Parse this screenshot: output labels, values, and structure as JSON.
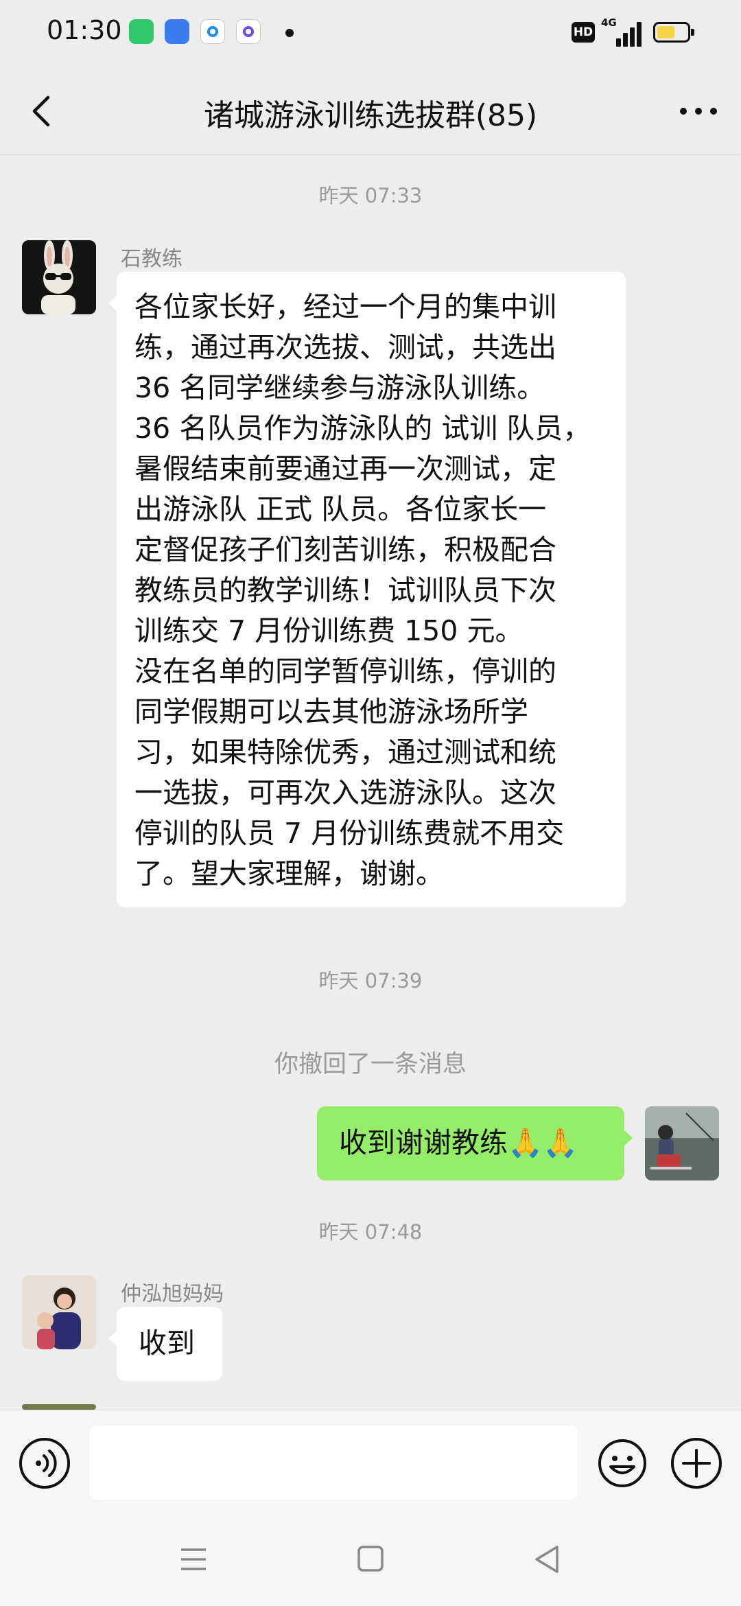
{
  "status_bar": {
    "time": "01:30",
    "hd": "HD",
    "network": "4G",
    "battery_percent": 60,
    "app_icons": [
      {
        "name": "green-app-icon",
        "color": "#2fc86b"
      },
      {
        "name": "blue-chat-app-icon",
        "color": "#3a7cf0"
      },
      {
        "name": "blue-dot-app-icon",
        "color": "#1d8bf0"
      },
      {
        "name": "purple-app-icon",
        "color": "#6b4fd6"
      }
    ]
  },
  "header": {
    "title": "诸城游泳训练选拔群(85)",
    "back_icon": "chevron-left-icon",
    "more_icon": "more-dots-icon"
  },
  "messages": [
    {
      "time": "昨天 07:33",
      "sender": "石教练",
      "lines": [
        "各位家长好，经过一个月的集中训",
        "练，通过再次选拔、测试，共选出",
        "36 名同学继续参与游泳队训练。",
        "36 名队员作为游泳队的 试训 队员，",
        "暑假结束前要通过再一次测试，定",
        "出游泳队 正式 队员。各位家长一",
        "定督促孩子们刻苦训练，积极配合",
        "教练员的教学训练！试训队员下次",
        "训练交 7 月份训练费 150 元。",
        "没在名单的同学暂停训练，停训的",
        "同学假期可以去其他游泳场所学",
        "习，如果特除优秀，通过测试和统",
        "一选拔，可再次入选游泳队。这次",
        "停训的队员 7 月份训练费就不用交",
        "了。望大家理解，谢谢。"
      ]
    },
    {
      "time": "昨天 07:39",
      "recall_notice": "你撤回了一条消息",
      "self_text": "收到谢谢教练🙏🙏"
    },
    {
      "time": "昨天 07:48",
      "sender": "仲泓旭妈妈",
      "text": "收到"
    }
  ],
  "input_bar": {
    "voice_icon": "voice-icon",
    "emoji_icon": "emoji-icon",
    "plus_icon": "plus-icon",
    "input_value": ""
  },
  "nav_bar": {
    "menu_icon": "menu-icon",
    "home_icon": "home-icon",
    "back_icon": "back-triangle-icon"
  },
  "colors": {
    "background": "#ededed",
    "self_bubble": "#95ec69",
    "other_bubble": "#ffffff",
    "battery_fill": "#f5d546"
  }
}
